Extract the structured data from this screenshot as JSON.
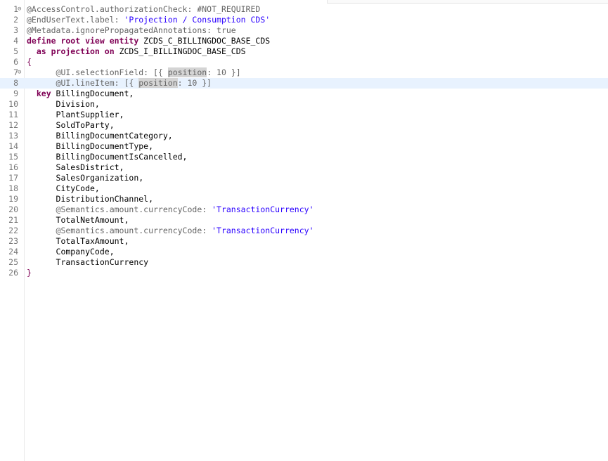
{
  "editor": {
    "lines": [
      {
        "n": "1",
        "fold": "⊖",
        "segments": [
          {
            "t": "@AccessControl.authorizationCheck: #NOT_REQUIRED",
            "c": "annot"
          }
        ]
      },
      {
        "n": "2",
        "segments": [
          {
            "t": "@EndUserText.label: ",
            "c": "annot"
          },
          {
            "t": "'Projection / Consumption CDS'",
            "c": "str"
          }
        ]
      },
      {
        "n": "3",
        "segments": [
          {
            "t": "@Metadata.ignorePropagatedAnnotations: true",
            "c": "annot"
          }
        ]
      },
      {
        "n": "4",
        "segments": [
          {
            "t": "define root view entity ",
            "c": "kw"
          },
          {
            "t": "ZCDS_C_BILLINGDOC_BASE_CDS",
            "c": ""
          }
        ]
      },
      {
        "n": "5",
        "segments": [
          {
            "t": "  as projection on ",
            "c": "kw"
          },
          {
            "t": "ZCDS_I_BILLINGDOC_BASE_CDS",
            "c": ""
          }
        ]
      },
      {
        "n": "6",
        "segments": [
          {
            "t": "{",
            "c": "brace"
          }
        ]
      },
      {
        "n": "7",
        "fold": "⊖",
        "segments": [
          {
            "t": "      @UI.selectionField: [{ ",
            "c": "annot"
          },
          {
            "t": "position",
            "c": "annot hl"
          },
          {
            "t": ": 10 }]",
            "c": "annot"
          }
        ]
      },
      {
        "n": "8",
        "current": true,
        "segments": [
          {
            "t": "      @UI.lineItem: [{ ",
            "c": "annot"
          },
          {
            "t": "position",
            "c": "annot hl"
          },
          {
            "t": ": 10 }]",
            "c": "annot"
          }
        ]
      },
      {
        "n": "9",
        "segments": [
          {
            "t": "  key ",
            "c": "kw"
          },
          {
            "t": "BillingDocument,",
            "c": ""
          }
        ]
      },
      {
        "n": "10",
        "segments": [
          {
            "t": "      Division,",
            "c": ""
          }
        ]
      },
      {
        "n": "11",
        "segments": [
          {
            "t": "      PlantSupplier,",
            "c": ""
          }
        ]
      },
      {
        "n": "12",
        "segments": [
          {
            "t": "      SoldToParty,",
            "c": ""
          }
        ]
      },
      {
        "n": "13",
        "segments": [
          {
            "t": "      BillingDocumentCategory,",
            "c": ""
          }
        ]
      },
      {
        "n": "14",
        "segments": [
          {
            "t": "      BillingDocumentType,",
            "c": ""
          }
        ]
      },
      {
        "n": "15",
        "segments": [
          {
            "t": "      BillingDocumentIsCancelled,",
            "c": ""
          }
        ]
      },
      {
        "n": "16",
        "segments": [
          {
            "t": "      SalesDistrict,",
            "c": ""
          }
        ]
      },
      {
        "n": "17",
        "segments": [
          {
            "t": "      SalesOrganization,",
            "c": ""
          }
        ]
      },
      {
        "n": "18",
        "segments": [
          {
            "t": "      CityCode,",
            "c": ""
          }
        ]
      },
      {
        "n": "19",
        "segments": [
          {
            "t": "      DistributionChannel,",
            "c": ""
          }
        ]
      },
      {
        "n": "20",
        "segments": [
          {
            "t": "      @Semantics.amount.currencyCode: ",
            "c": "annot"
          },
          {
            "t": "'TransactionCurrency'",
            "c": "str"
          }
        ]
      },
      {
        "n": "21",
        "segments": [
          {
            "t": "      TotalNetAmount,",
            "c": ""
          }
        ]
      },
      {
        "n": "22",
        "segments": [
          {
            "t": "      @Semantics.amount.currencyCode: ",
            "c": "annot"
          },
          {
            "t": "'TransactionCurrency'",
            "c": "str"
          }
        ]
      },
      {
        "n": "23",
        "segments": [
          {
            "t": "      TotalTaxAmount,",
            "c": ""
          }
        ]
      },
      {
        "n": "24",
        "segments": [
          {
            "t": "      CompanyCode,",
            "c": ""
          }
        ]
      },
      {
        "n": "25",
        "segments": [
          {
            "t": "      TransactionCurrency",
            "c": ""
          }
        ]
      },
      {
        "n": "26",
        "segments": [
          {
            "t": "}",
            "c": "brace"
          }
        ]
      }
    ]
  },
  "colors": {
    "keyword": "#7f0055",
    "annotation": "#3f5fbf",
    "string": "#2a00ff",
    "current_line": "#e8f2fe",
    "occurrence_highlight": "#d4d4d4"
  }
}
